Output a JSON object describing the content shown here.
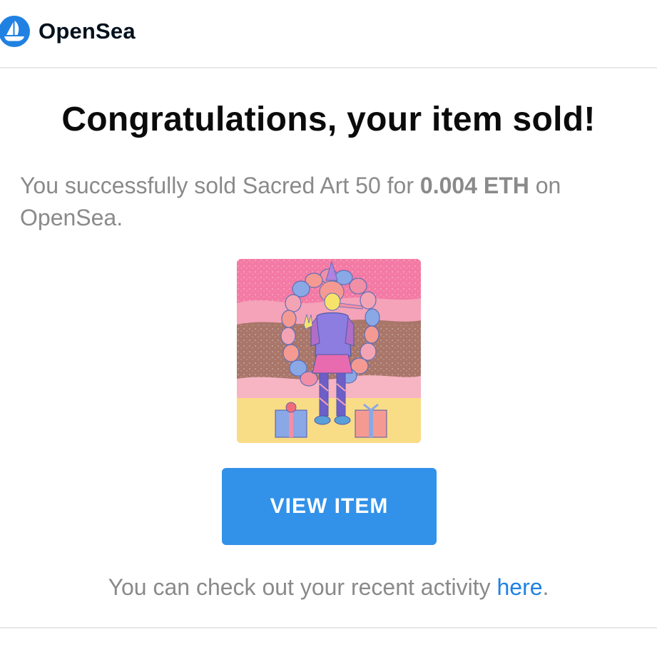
{
  "brand": {
    "name": "OpenSea",
    "logo_icon": "opensea-sailboat-icon",
    "accent_color": "#2081e2"
  },
  "email": {
    "title": "Congratulations, your item sold!",
    "message_prefix": "You successfully sold Sacred Art 50 for ",
    "price": "0.004 ETH",
    "message_suffix": " on OpenSea.",
    "button_label": "VIEW ITEM",
    "button_color": "#3291e9",
    "activity_prefix": "You can check out your recent activity ",
    "activity_link": "here",
    "activity_suffix": "."
  },
  "item": {
    "image": "nft-artwork-girl-with-balloons-and-gifts"
  }
}
